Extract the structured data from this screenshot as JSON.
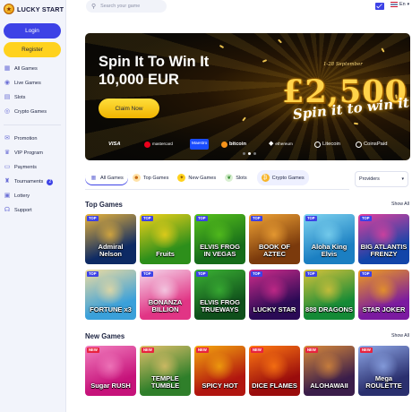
{
  "brand": {
    "name": "LUCKY START"
  },
  "sidebar": {
    "login_label": "Login",
    "register_label": "Register",
    "menu_top": [
      {
        "label": "All Games",
        "icon": "grid-icon"
      },
      {
        "label": "Live Games",
        "icon": "live-icon"
      },
      {
        "label": "Slots",
        "icon": "slots-icon"
      },
      {
        "label": "Crypto Games",
        "icon": "crypto-icon"
      }
    ],
    "menu_bottom": [
      {
        "label": "Promotion",
        "icon": "gift-icon"
      },
      {
        "label": "VIP Program",
        "icon": "crown-icon"
      },
      {
        "label": "Payments",
        "icon": "card-icon"
      },
      {
        "label": "Tournaments",
        "icon": "trophy-icon",
        "badge": "2"
      },
      {
        "label": "Lottery",
        "icon": "ticket-icon"
      },
      {
        "label": "Support",
        "icon": "support-icon"
      }
    ]
  },
  "header": {
    "search_placeholder": "Search your game",
    "language": "En"
  },
  "banner": {
    "headline_line1": "Spin It To Win It",
    "headline_line2": "10,000 EUR",
    "cta_label": "Claim Now",
    "promo_dates": "1-28 September",
    "promo_amount": "£2,500",
    "promo_subtitle": "Spin it to win it",
    "payment_logos": [
      "VISA",
      "mastercard",
      "Maestro",
      "bitcoin",
      "ethereum",
      "Litecoin",
      "CoinsPaid"
    ]
  },
  "filters": {
    "tabs": [
      {
        "label": "All Games",
        "icon": "grid-icon"
      },
      {
        "label": "Top Games",
        "icon": "people-icon"
      },
      {
        "label": "New Games",
        "icon": "new-icon"
      },
      {
        "label": "Slots",
        "icon": "slots-icon"
      },
      {
        "label": "Crypto Games",
        "icon": "crypto-icon"
      }
    ],
    "active_tab": "All Games",
    "providers_label": "Providers"
  },
  "top_games": {
    "title": "Top Games",
    "show_all_label": "Show All",
    "tag_label": "TOP",
    "games": [
      {
        "title": "Admiral Nelson",
        "bg": "#0d2a64",
        "bg2": "#e9b43a"
      },
      {
        "title": "Fruits",
        "bg": "#2d8f1b",
        "bg2": "#f3d21a"
      },
      {
        "title": "ELVIS FROG IN VEGAS",
        "bg": "#166c1a",
        "bg2": "#58c21c"
      },
      {
        "title": "BOOK OF AZTEC",
        "bg": "#7b3a0c",
        "bg2": "#f1a435"
      },
      {
        "title": "Aloha King Elvis",
        "bg": "#1b7fc2",
        "bg2": "#7fd4f0"
      },
      {
        "title": "BIG ATLANTIS FRENZY",
        "bg": "#1245a9",
        "bg2": "#e3409c"
      },
      {
        "title": "FORTUNE x3",
        "bg": "#3aa0da",
        "bg2": "#efdca0"
      },
      {
        "title": "BONANZA BILLION",
        "bg": "#e13585",
        "bg2": "#f5d9ec"
      },
      {
        "title": "ELVIS FROG TRUEWAYS",
        "bg": "#0f4f1b",
        "bg2": "#3cb334"
      },
      {
        "title": "LUCKY STAR",
        "bg": "#2a0a55",
        "bg2": "#d12c8c"
      },
      {
        "title": "888 DRAGONS",
        "bg": "#148a36",
        "bg2": "#d9c33b"
      },
      {
        "title": "STAR JOKER",
        "bg": "#7b1aa0",
        "bg2": "#f09f1c"
      }
    ]
  },
  "new_games": {
    "title": "New Games",
    "show_all_label": "Show All",
    "tag_label": "NEW",
    "games": [
      {
        "title": "Sugar RUSH",
        "bg": "#c6127a",
        "bg2": "#f27fbf"
      },
      {
        "title": "TEMPLE TUMBLE",
        "bg": "#2f7f2a",
        "bg2": "#e0c06a"
      },
      {
        "title": "SPICY HOT",
        "bg": "#b1150f",
        "bg2": "#f5a90d"
      },
      {
        "title": "DICE FLAMES",
        "bg": "#9a0c0c",
        "bg2": "#ff7a12"
      },
      {
        "title": "ALOHAWAII",
        "bg": "#3a1d4a",
        "bg2": "#d98a3a"
      },
      {
        "title": "Mega ROULETTE",
        "bg": "#2a2f6e",
        "bg2": "#8fa8e8"
      }
    ]
  }
}
